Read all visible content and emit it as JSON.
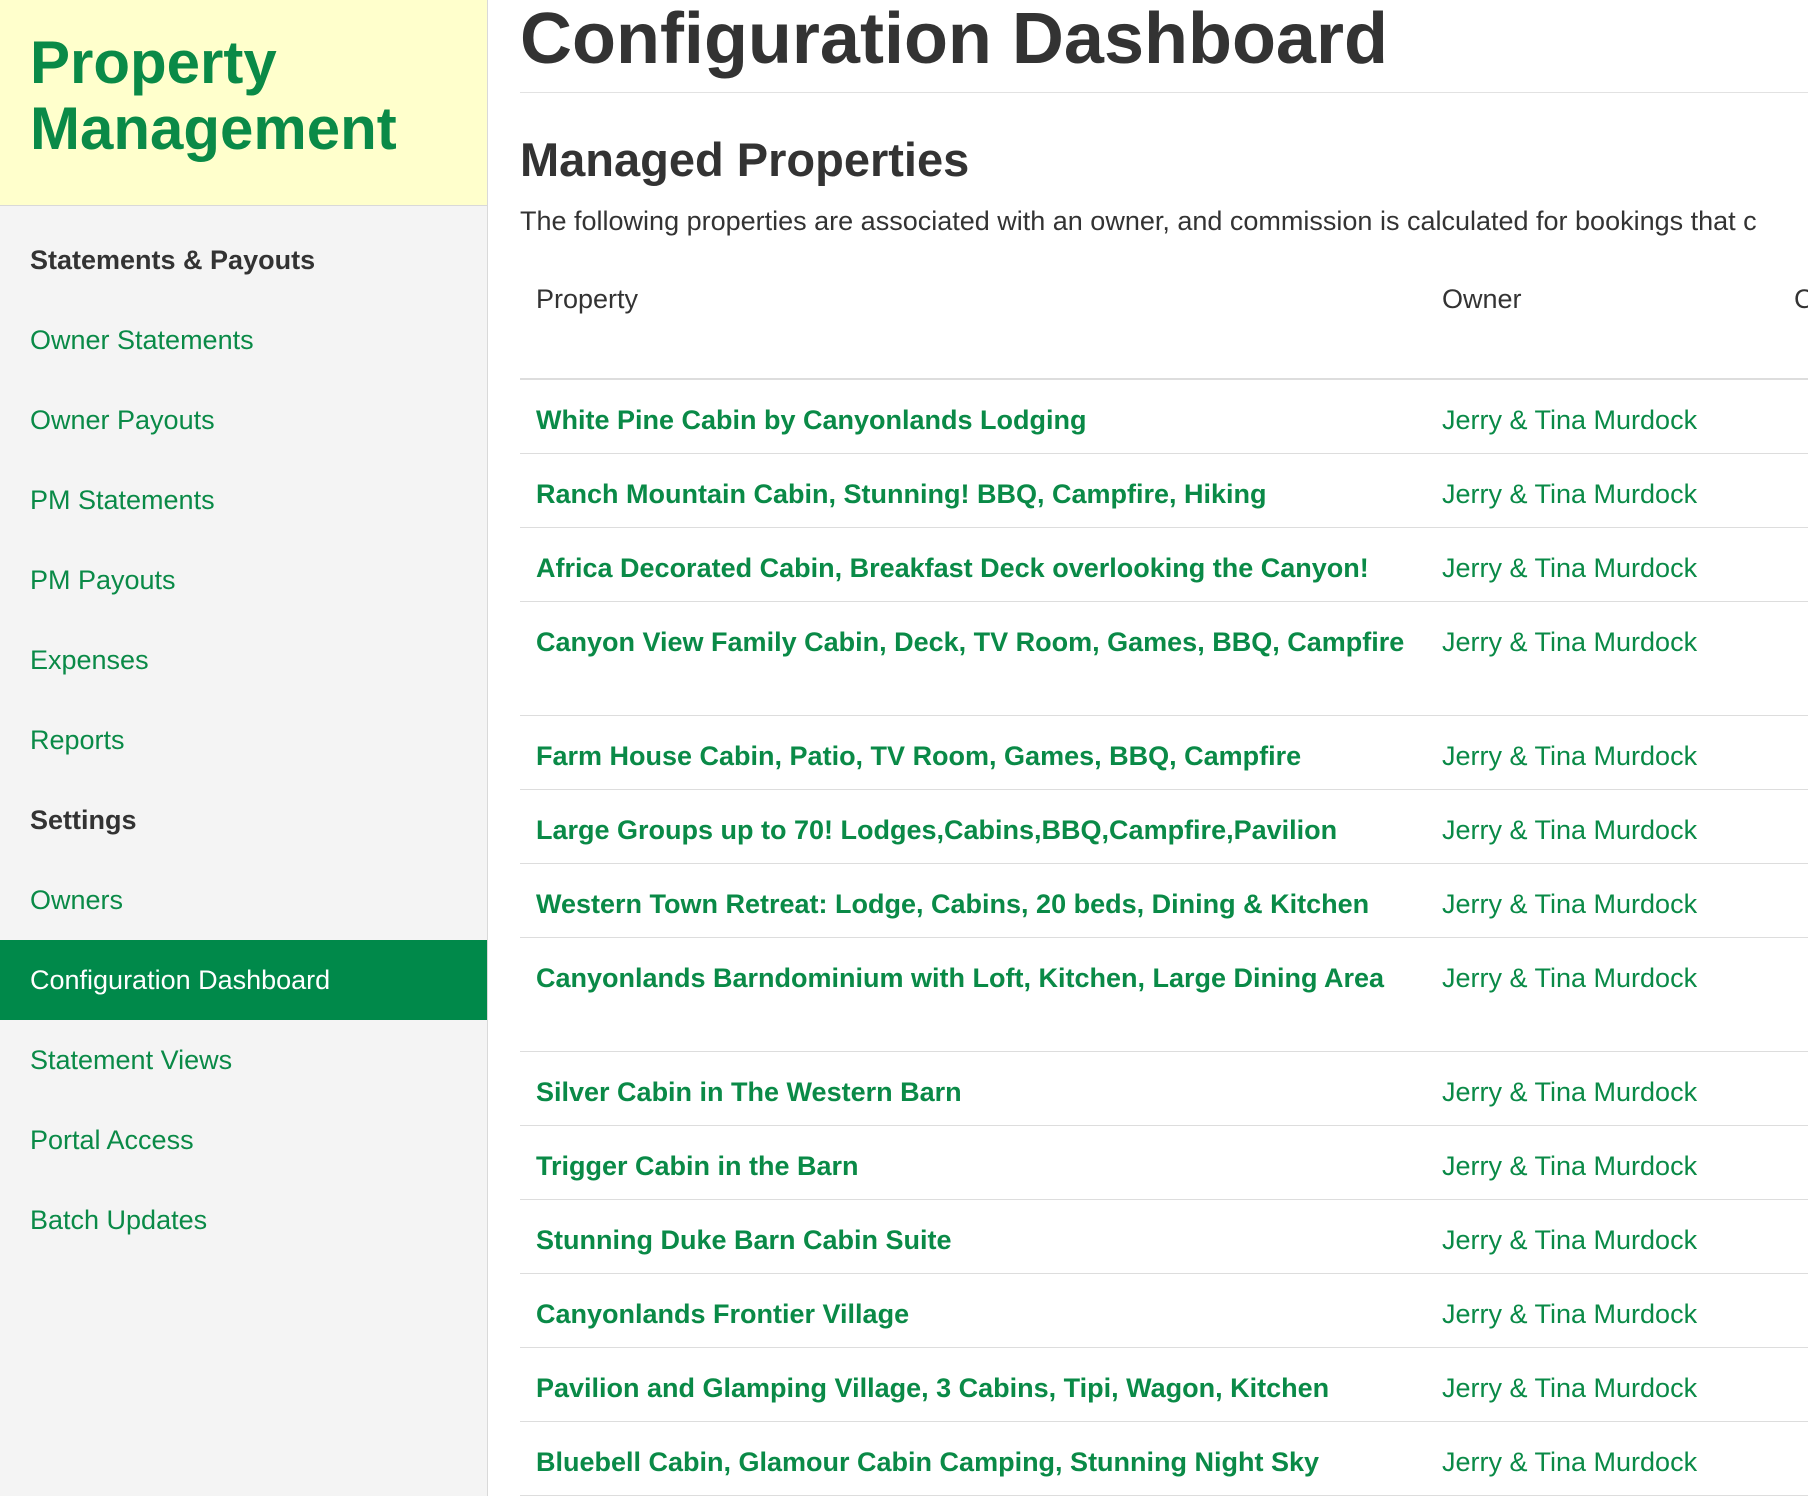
{
  "sidebar": {
    "brand": "Property Management",
    "sections": [
      {
        "heading": "Statements & Payouts",
        "items": [
          "Owner Statements",
          "Owner Payouts",
          "PM Statements",
          "PM Payouts",
          "Expenses",
          "Reports"
        ]
      },
      {
        "heading": "Settings",
        "items": [
          "Owners",
          "Configuration Dashboard",
          "Statement Views",
          "Portal Access",
          "Batch Updates"
        ]
      }
    ],
    "active_item": "Configuration Dashboard"
  },
  "main": {
    "title": "Configuration Dashboard",
    "section_title": "Managed Properties",
    "section_desc": "The following properties are associated with an owner, and commission is calculated for bookings that c",
    "columns": [
      "Property",
      "Owner",
      "C"
    ],
    "rows": [
      {
        "property": "White Pine Cabin by Canyonlands Lodging",
        "owner": "Jerry & Tina Murdock",
        "lines": 1
      },
      {
        "property": "Ranch Mountain Cabin, Stunning! BBQ, Campfire, Hiking",
        "owner": "Jerry & Tina Murdock",
        "lines": 1
      },
      {
        "property": "Africa Decorated Cabin, Breakfast Deck overlooking the Canyon!",
        "owner": "Jerry & Tina Murdock",
        "lines": 1
      },
      {
        "property": "Canyon View Family Cabin, Deck, TV Room, Games, BBQ, Campfire",
        "owner": "Jerry & Tina Murdock",
        "lines": 2
      },
      {
        "property": "Farm House Cabin, Patio, TV Room, Games, BBQ, Campfire",
        "owner": "Jerry & Tina Murdock",
        "lines": 1
      },
      {
        "property": "Large Groups up to 70! Lodges,Cabins,BBQ,Campfire,Pavilion",
        "owner": "Jerry & Tina Murdock",
        "lines": 1
      },
      {
        "property": "Western Town Retreat: Lodge, Cabins, 20 beds, Dining & Kitchen",
        "owner": "Jerry & Tina Murdock",
        "lines": 1
      },
      {
        "property": "Canyonlands Barndominium with Loft, Kitchen, Large Dining Area",
        "owner": "Jerry & Tina Murdock",
        "lines": 2
      },
      {
        "property": "Silver Cabin in The Western Barn",
        "owner": "Jerry & Tina Murdock",
        "lines": 1
      },
      {
        "property": "Trigger Cabin in the Barn",
        "owner": "Jerry & Tina Murdock",
        "lines": 1
      },
      {
        "property": "Stunning Duke Barn Cabin Suite",
        "owner": "Jerry & Tina Murdock",
        "lines": 1
      },
      {
        "property": "Canyonlands Frontier Village",
        "owner": "Jerry & Tina Murdock",
        "lines": 1
      },
      {
        "property": "Pavilion and Glamping Village, 3 Cabins, Tipi, Wagon, Kitchen",
        "owner": "Jerry & Tina Murdock",
        "lines": 1
      },
      {
        "property": "Bluebell Cabin, Glamour Cabin Camping, Stunning Night Sky",
        "owner": "Jerry & Tina Murdock",
        "lines": 1
      }
    ]
  }
}
